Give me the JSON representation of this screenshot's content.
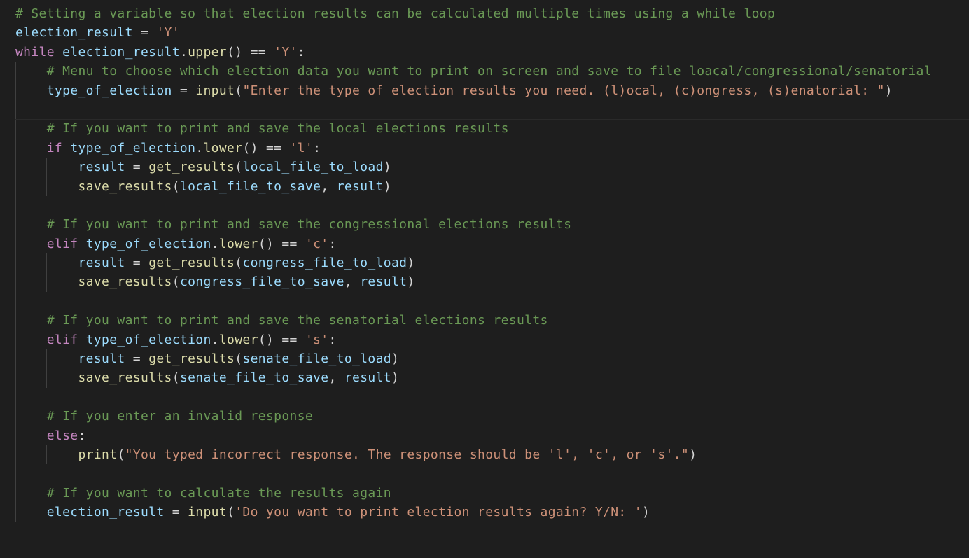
{
  "editor": {
    "language": "python",
    "lines": [
      {
        "indent": 0,
        "tokens": [
          {
            "t": "comment",
            "v": "# Setting a variable so that election results can be calculated multiple times using a while loop"
          }
        ]
      },
      {
        "indent": 0,
        "tokens": [
          {
            "t": "var",
            "v": "election_result"
          },
          {
            "t": "op",
            "v": " = "
          },
          {
            "t": "str",
            "v": "'Y'"
          }
        ]
      },
      {
        "indent": 0,
        "tokens": [
          {
            "t": "kw",
            "v": "while"
          },
          {
            "t": "op",
            "v": " "
          },
          {
            "t": "var",
            "v": "election_result"
          },
          {
            "t": "punc",
            "v": "."
          },
          {
            "t": "fn",
            "v": "upper"
          },
          {
            "t": "punc",
            "v": "() == "
          },
          {
            "t": "str",
            "v": "'Y'"
          },
          {
            "t": "punc",
            "v": ":"
          }
        ]
      },
      {
        "indent": 1,
        "tokens": [
          {
            "t": "comment",
            "v": "# Menu to choose which election data you want to print on screen and save to file loacal/congressional/senatorial"
          }
        ]
      },
      {
        "indent": 1,
        "tokens": [
          {
            "t": "var",
            "v": "type_of_election"
          },
          {
            "t": "op",
            "v": " = "
          },
          {
            "t": "fn",
            "v": "input"
          },
          {
            "t": "punc",
            "v": "("
          },
          {
            "t": "str",
            "v": "\"Enter the type of election results you need. (l)ocal, (c)ongress, (s)enatorial: \""
          },
          {
            "t": "punc",
            "v": ")"
          }
        ]
      },
      {
        "indent": 1,
        "tokens": []
      },
      {
        "indent": 1,
        "tokens": [
          {
            "t": "comment",
            "v": "# If you want to print and save the local elections results"
          }
        ]
      },
      {
        "indent": 1,
        "tokens": [
          {
            "t": "kw",
            "v": "if"
          },
          {
            "t": "op",
            "v": " "
          },
          {
            "t": "var",
            "v": "type_of_election"
          },
          {
            "t": "punc",
            "v": "."
          },
          {
            "t": "fn",
            "v": "lower"
          },
          {
            "t": "punc",
            "v": "() == "
          },
          {
            "t": "str",
            "v": "'l'"
          },
          {
            "t": "punc",
            "v": ":"
          }
        ]
      },
      {
        "indent": 2,
        "tokens": [
          {
            "t": "var",
            "v": "result"
          },
          {
            "t": "op",
            "v": " = "
          },
          {
            "t": "fn",
            "v": "get_results"
          },
          {
            "t": "punc",
            "v": "("
          },
          {
            "t": "var",
            "v": "local_file_to_load"
          },
          {
            "t": "punc",
            "v": ")"
          }
        ]
      },
      {
        "indent": 2,
        "tokens": [
          {
            "t": "fn",
            "v": "save_results"
          },
          {
            "t": "punc",
            "v": "("
          },
          {
            "t": "var",
            "v": "local_file_to_save"
          },
          {
            "t": "punc",
            "v": ", "
          },
          {
            "t": "var",
            "v": "result"
          },
          {
            "t": "punc",
            "v": ")"
          }
        ]
      },
      {
        "indent": 1,
        "tokens": []
      },
      {
        "indent": 1,
        "tokens": [
          {
            "t": "comment",
            "v": "# If you want to print and save the congressional elections results"
          }
        ]
      },
      {
        "indent": 1,
        "tokens": [
          {
            "t": "kw",
            "v": "elif"
          },
          {
            "t": "op",
            "v": " "
          },
          {
            "t": "var",
            "v": "type_of_election"
          },
          {
            "t": "punc",
            "v": "."
          },
          {
            "t": "fn",
            "v": "lower"
          },
          {
            "t": "punc",
            "v": "() == "
          },
          {
            "t": "str",
            "v": "'c'"
          },
          {
            "t": "punc",
            "v": ":"
          }
        ]
      },
      {
        "indent": 2,
        "tokens": [
          {
            "t": "var",
            "v": "result"
          },
          {
            "t": "op",
            "v": " = "
          },
          {
            "t": "fn",
            "v": "get_results"
          },
          {
            "t": "punc",
            "v": "("
          },
          {
            "t": "var",
            "v": "congress_file_to_load"
          },
          {
            "t": "punc",
            "v": ")"
          }
        ]
      },
      {
        "indent": 2,
        "tokens": [
          {
            "t": "fn",
            "v": "save_results"
          },
          {
            "t": "punc",
            "v": "("
          },
          {
            "t": "var",
            "v": "congress_file_to_save"
          },
          {
            "t": "punc",
            "v": ", "
          },
          {
            "t": "var",
            "v": "result"
          },
          {
            "t": "punc",
            "v": ")"
          }
        ]
      },
      {
        "indent": 1,
        "tokens": []
      },
      {
        "indent": 1,
        "tokens": [
          {
            "t": "comment",
            "v": "# If you want to print and save the senatorial elections results"
          }
        ]
      },
      {
        "indent": 1,
        "tokens": [
          {
            "t": "kw",
            "v": "elif"
          },
          {
            "t": "op",
            "v": " "
          },
          {
            "t": "var",
            "v": "type_of_election"
          },
          {
            "t": "punc",
            "v": "."
          },
          {
            "t": "fn",
            "v": "lower"
          },
          {
            "t": "punc",
            "v": "() == "
          },
          {
            "t": "str",
            "v": "'s'"
          },
          {
            "t": "punc",
            "v": ":"
          }
        ]
      },
      {
        "indent": 2,
        "tokens": [
          {
            "t": "var",
            "v": "result"
          },
          {
            "t": "op",
            "v": " = "
          },
          {
            "t": "fn",
            "v": "get_results"
          },
          {
            "t": "punc",
            "v": "("
          },
          {
            "t": "var",
            "v": "senate_file_to_load"
          },
          {
            "t": "punc",
            "v": ")"
          }
        ]
      },
      {
        "indent": 2,
        "tokens": [
          {
            "t": "fn",
            "v": "save_results"
          },
          {
            "t": "punc",
            "v": "("
          },
          {
            "t": "var",
            "v": "senate_file_to_save"
          },
          {
            "t": "punc",
            "v": ", "
          },
          {
            "t": "var",
            "v": "result"
          },
          {
            "t": "punc",
            "v": ")"
          }
        ]
      },
      {
        "indent": 1,
        "tokens": []
      },
      {
        "indent": 1,
        "tokens": [
          {
            "t": "comment",
            "v": "# If you enter an invalid response"
          }
        ]
      },
      {
        "indent": 1,
        "tokens": [
          {
            "t": "kw",
            "v": "else"
          },
          {
            "t": "punc",
            "v": ":"
          }
        ]
      },
      {
        "indent": 2,
        "tokens": [
          {
            "t": "fn",
            "v": "print"
          },
          {
            "t": "punc",
            "v": "("
          },
          {
            "t": "str",
            "v": "\"You typed incorrect response. The response should be 'l', 'c', or 's'.\""
          },
          {
            "t": "punc",
            "v": ")"
          }
        ]
      },
      {
        "indent": 1,
        "tokens": []
      },
      {
        "indent": 1,
        "tokens": [
          {
            "t": "comment",
            "v": "# If you want to calculate the results again"
          }
        ]
      },
      {
        "indent": 1,
        "tokens": [
          {
            "t": "var",
            "v": "election_result"
          },
          {
            "t": "op",
            "v": " = "
          },
          {
            "t": "fn",
            "v": "input"
          },
          {
            "t": "punc",
            "v": "("
          },
          {
            "t": "str",
            "v": "'Do you want to print election results again? Y/N: '"
          },
          {
            "t": "punc",
            "v": ")"
          }
        ]
      }
    ]
  },
  "colors": {
    "background": "#1e1e1e",
    "comment": "#6a9955",
    "variable": "#9cdcfe",
    "string": "#ce9178",
    "keyword": "#c586c0",
    "function": "#dcdcaa",
    "plain": "#d4d4d4"
  }
}
